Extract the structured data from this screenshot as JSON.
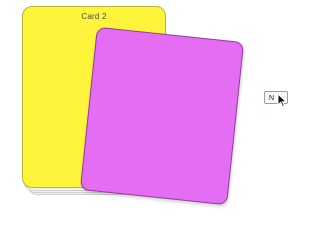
{
  "cards": {
    "yellow_card": {
      "title": "Card 2",
      "color": "#fdf43b"
    },
    "magenta_card": {
      "color": "#e46df3"
    }
  },
  "controls": {
    "next_button_label": "N"
  },
  "icons": {
    "cursor": "arrow-cursor-icon"
  }
}
